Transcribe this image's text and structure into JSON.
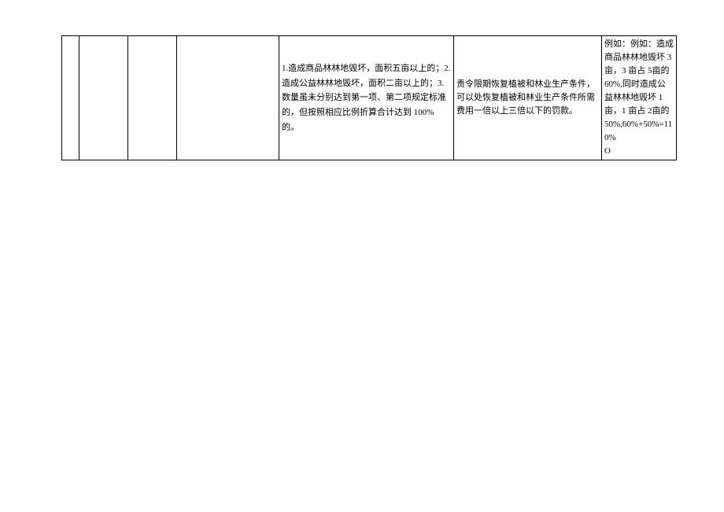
{
  "table": {
    "row": {
      "col1": "",
      "col2": "",
      "col3": "",
      "col4": "",
      "criteria": "1.造成商品林林地毁坏，面积五亩以上的；2.造成公益林林地毁坏，面积二亩以上的；3.数量虽未分别达到第一项、第二项规定标准的，但按照相应比例折算合计达到 100%的。",
      "penalty": "责令限期恢复植被和林业生产条件，可以处恢复植被和林业生产条件所需费用一倍以上三倍以下的罚款。",
      "note_line1": "例如：例如：造成商品林林地毁坏 3 亩，3 亩占 5亩的 60%,同时造成公益林林地毁坏 1 亩，1 亩占 2亩的",
      "note_line2": "50%,60%+50%=110%",
      "note_line3": "O"
    }
  }
}
